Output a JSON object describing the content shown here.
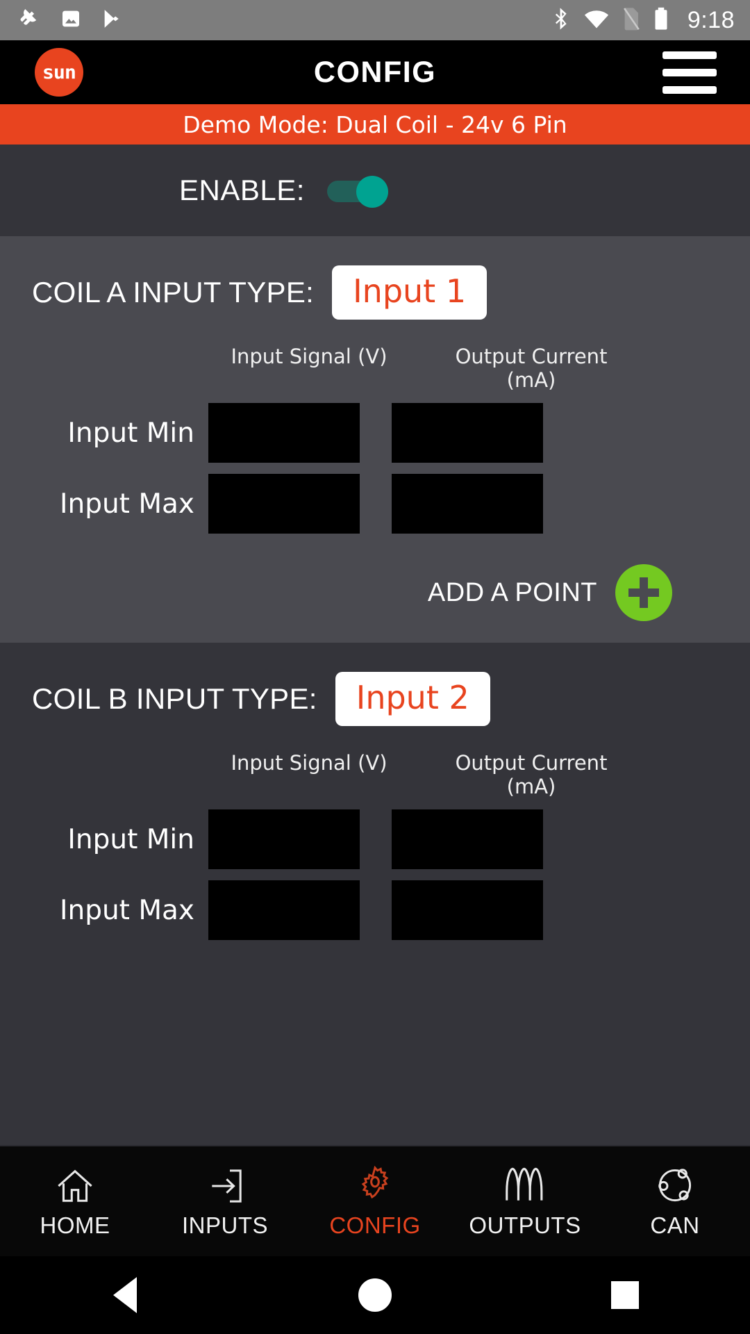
{
  "status_bar": {
    "icons_left": [
      "wrench-icon",
      "image-icon",
      "play-store-icon"
    ],
    "icons_right": [
      "bluetooth-icon",
      "wifi-icon",
      "no-sim-icon",
      "battery-icon"
    ],
    "clock": "9:18"
  },
  "app_bar": {
    "logo_text": "sun",
    "title": "CONFIG",
    "menu_icon": "hamburger-menu-icon"
  },
  "banner": {
    "text": "Demo Mode: Dual Coil - 24v 6 Pin",
    "color": "#e8441f"
  },
  "enable": {
    "label": "ENABLE:",
    "value": "on",
    "accent": "#00a391"
  },
  "coils": [
    {
      "id": "coil-a",
      "label": "COIL A INPUT TYPE:",
      "input_type": "Input 1",
      "columns": [
        "Input Signal (V)",
        "Output Current (mA)"
      ],
      "rows": [
        {
          "label": "Input Min",
          "input_signal": "",
          "output_current": ""
        },
        {
          "label": "Input Max",
          "input_signal": "",
          "output_current": ""
        }
      ],
      "add_point": {
        "label": "ADD A POINT",
        "icon": "plus-icon",
        "color": "#74c921"
      }
    },
    {
      "id": "coil-b",
      "label": "COIL B INPUT TYPE:",
      "input_type": "Input 2",
      "columns": [
        "Input Signal (V)",
        "Output Current (mA)"
      ],
      "rows": [
        {
          "label": "Input Min",
          "input_signal": "",
          "output_current": ""
        },
        {
          "label": "Input Max",
          "input_signal": "",
          "output_current": ""
        }
      ]
    }
  ],
  "bottom_nav": {
    "active": "CONFIG",
    "active_color": "#e8441f",
    "items": [
      {
        "label": "HOME",
        "icon": "home-icon"
      },
      {
        "label": "INPUTS",
        "icon": "arrow-into-box-icon"
      },
      {
        "label": "CONFIG",
        "icon": "gear-icon"
      },
      {
        "label": "OUTPUTS",
        "icon": "waveform-icon"
      },
      {
        "label": "CAN",
        "icon": "network-nodes-icon"
      }
    ]
  },
  "system_nav": {
    "back": "back-triangle-icon",
    "home": "home-circle-icon",
    "recents": "recents-square-icon"
  }
}
